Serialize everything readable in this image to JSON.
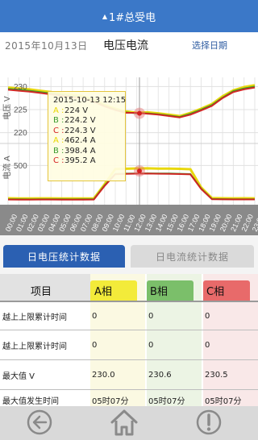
{
  "header": {
    "title": "1#总受电"
  },
  "toolbar": {
    "date": "2015年10月13日",
    "chart_title": "电压电流",
    "pick_date": "选择日期"
  },
  "chart_data": {
    "type": "line",
    "voltage_axis": {
      "label": "电压 V",
      "ticks": [
        230,
        225,
        220
      ],
      "ylim": [
        218,
        232
      ]
    },
    "current_axis": {
      "label": "电流 A",
      "ticks": [
        500
      ],
      "ylim": [
        0,
        760
      ]
    },
    "x": [
      "00:00",
      "01:00",
      "02:00",
      "03:00",
      "04:00",
      "05:00",
      "06:00",
      "07:00",
      "08:00",
      "09:00",
      "10:00",
      "11:00",
      "12:00",
      "13:00",
      "14:00",
      "15:00",
      "16:00",
      "17:00",
      "18:00",
      "19:00",
      "20:00",
      "21:00",
      "22:00",
      "23:00"
    ],
    "series": [
      {
        "name": "A",
        "group": "voltage",
        "color": "#e8d600",
        "values": [
          229.8,
          229.6,
          229.4,
          229.1,
          228.8,
          228.5,
          228.2,
          227.9,
          227.1,
          226.0,
          225.2,
          224.6,
          224.3,
          224.4,
          224.2,
          223.9,
          223.6,
          224.3,
          225.2,
          226.2,
          227.9,
          229.2,
          229.9,
          230.3
        ]
      },
      {
        "name": "B",
        "group": "voltage",
        "color": "#3a9a2c",
        "values": [
          229.5,
          229.3,
          229.1,
          228.8,
          228.5,
          228.2,
          227.9,
          227.6,
          226.9,
          225.8,
          225.0,
          224.4,
          224.2,
          224.2,
          224.0,
          223.7,
          223.4,
          224.1,
          225.0,
          226.0,
          227.6,
          229.0,
          229.6,
          230.0
        ]
      },
      {
        "name": "C",
        "group": "voltage",
        "color": "#d42020",
        "values": [
          229.3,
          229.1,
          228.9,
          228.6,
          228.3,
          228.0,
          227.7,
          227.4,
          226.7,
          225.7,
          224.9,
          224.3,
          224.3,
          224.1,
          223.9,
          223.6,
          223.3,
          223.9,
          224.8,
          225.8,
          227.5,
          228.8,
          229.4,
          229.8
        ]
      },
      {
        "name": "A",
        "group": "current",
        "color": "#e8d600",
        "values": [
          82,
          80,
          80,
          81,
          81,
          80,
          79,
          80,
          81,
          260,
          455,
          458,
          462,
          463,
          460,
          460,
          457,
          452,
          220,
          84,
          82,
          81,
          82,
          81
        ]
      },
      {
        "name": "B",
        "group": "current",
        "color": "#3a9a2c",
        "values": [
          70,
          69,
          68,
          69,
          70,
          69,
          68,
          69,
          70,
          245,
          392,
          396,
          398,
          400,
          398,
          397,
          394,
          390,
          205,
          73,
          71,
          70,
          70,
          70
        ]
      },
      {
        "name": "C",
        "group": "current",
        "color": "#d42020",
        "values": [
          66,
          65,
          65,
          66,
          66,
          65,
          64,
          65,
          66,
          238,
          388,
          392,
          395,
          396,
          394,
          393,
          390,
          386,
          200,
          70,
          68,
          67,
          67,
          67
        ]
      }
    ]
  },
  "tooltip": {
    "timestamp": "2015-10-13 12:15",
    "rows": [
      {
        "key": "A :",
        "value": "224 V",
        "color": "#e8d600"
      },
      {
        "key": "B :",
        "value": "224.2 V",
        "color": "#3a9a2c"
      },
      {
        "key": "C :",
        "value": "224.3 V",
        "color": "#d42020"
      },
      {
        "key": "A :",
        "value": "462.4 A",
        "color": "#e8d600"
      },
      {
        "key": "B :",
        "value": "398.4 A",
        "color": "#3a9a2c"
      },
      {
        "key": "C :",
        "value": "395.2 A",
        "color": "#d42020"
      }
    ]
  },
  "tabs": {
    "voltage": "日电压统计数据",
    "current": "日电流统计数据"
  },
  "table": {
    "headers": [
      "项目",
      "A相",
      "B相",
      "C相"
    ],
    "rows": [
      [
        "越上上限累计时间",
        "0",
        "0",
        "0"
      ],
      [
        "越上上限累计时间",
        "0",
        "0",
        "0"
      ],
      [
        "最大值 V",
        "230.0",
        "230.6",
        "230.5"
      ],
      [
        "最大值发生时间",
        "05时07分",
        "05时07分",
        "05时07分"
      ]
    ]
  },
  "colors": {
    "titlebar": "#3b78c8",
    "tab_active": "#2b60b2"
  }
}
